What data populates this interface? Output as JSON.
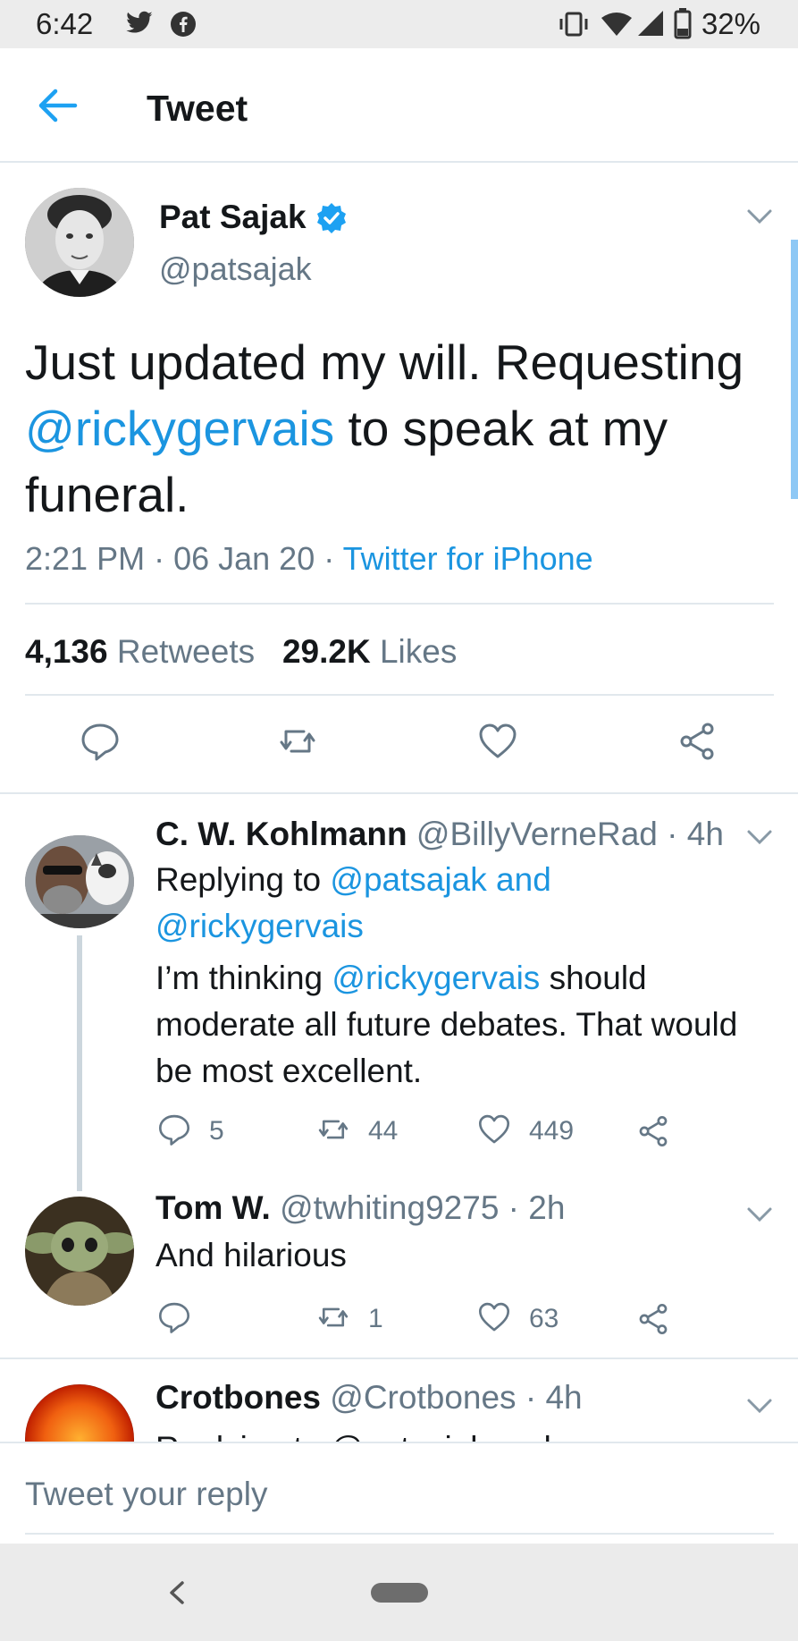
{
  "status_bar": {
    "time": "6:42",
    "battery": "32%"
  },
  "header": {
    "title": "Tweet"
  },
  "main_tweet": {
    "name": "Pat Sajak",
    "handle": "@patsajak",
    "text_1": "Just updated my will. Requesting ",
    "mention": "@rickygervais",
    "text_2": " to speak at my funeral.",
    "time": "2:21 PM",
    "date": "06 Jan 20",
    "source": "Twitter for iPhone",
    "retweets_count": "4,136",
    "retweets_label": "Retweets",
    "likes_count": "29.2K",
    "likes_label": "Likes"
  },
  "replies": [
    {
      "name": "C. W. Kohlmann",
      "handle": "@BillyVerneRad",
      "age": "4h",
      "replying_prefix": "Replying to ",
      "replying_to": "@patsajak and @rickygervais",
      "text_1": "I’m thinking ",
      "mention": "@rickygervais",
      "text_2": " should moderate all future debates. That would be most excellent.",
      "reply_count": "5",
      "retweet_count": "44",
      "like_count": "449"
    },
    {
      "name": "Tom W.",
      "handle": "@twhiting9275",
      "age": "2h",
      "text": "And hilarious",
      "reply_count": "",
      "retweet_count": "1",
      "like_count": "63"
    },
    {
      "name": "Crotbones",
      "handle": "@Crotbones",
      "age": "4h",
      "replying_partial": "Replying to @patsajak and"
    }
  ],
  "composer": {
    "placeholder": "Tweet your reply"
  },
  "colors": {
    "accent": "#1da1f2",
    "link": "#1b95e0",
    "muted": "#657786",
    "text": "#14171a"
  },
  "icons": [
    "twitter-icon",
    "facebook-icon",
    "vibrate-icon",
    "wifi-icon",
    "signal-icon",
    "battery-icon",
    "back-arrow-icon",
    "verified-badge-icon",
    "chevron-down-icon",
    "reply-icon",
    "retweet-icon",
    "like-icon",
    "share-icon"
  ]
}
